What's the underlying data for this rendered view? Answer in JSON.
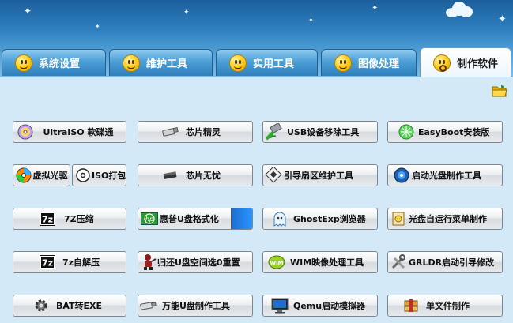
{
  "tabs": [
    {
      "label": "系统设置",
      "active": false
    },
    {
      "label": "维护工具",
      "active": false
    },
    {
      "label": "实用工具",
      "active": false
    },
    {
      "label": "图像处理",
      "active": false
    },
    {
      "label": "制作软件",
      "active": true
    }
  ],
  "buttons": {
    "ultraiso": "UltraISO 软碟通",
    "virtual_cd": "虚拟光驱",
    "iso_pack": "ISO打包",
    "zip7": "7Z压缩",
    "zip7_extract": "7z自解压",
    "bat2exe": "BAT转EXE",
    "chip_genius": "芯片精灵",
    "chip_wuyou": "芯片无忧",
    "hp_usb_format": "惠普U盘格式化",
    "usb_space_restore": "归还U盘空间选0重置",
    "usb_maker": "万能U盘制作工具",
    "usb_remove": "USB设备移除工具",
    "boot_sector": "引导扇区维护工具",
    "ghostexp": "GhostExp浏览器",
    "wim_tool": "WIM映像处理工具",
    "qemu": "Qemu启动模拟器",
    "easyboot": "EasyBoot安装版",
    "boot_cd_maker": "启动光盘制作工具",
    "autorun_menu": "光盘自运行菜单制作",
    "grldr": "GRLDR启动引导修改",
    "single_file": "单文件制作"
  },
  "colors": {
    "sky_top": "#1b5f9c",
    "content_bg": "#d3e9f7",
    "button_border": "#7d8791"
  },
  "icons": [
    "folder-icon",
    "smiley-icon",
    "cd-icon",
    "usb-stick-icon",
    "7z-icon",
    "gear-icon",
    "hp-icon",
    "monitor-icon"
  ]
}
